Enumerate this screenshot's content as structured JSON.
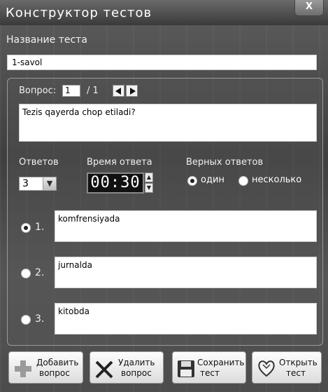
{
  "window": {
    "title": "Конструктор тестов",
    "close_label": "X"
  },
  "test_name": {
    "label": "Название теста",
    "value": "1-savol"
  },
  "question_nav": {
    "label": "Вопрос:",
    "current": "1",
    "total": "/ 1"
  },
  "question_text": "Tezis qayerda chop etiladi?",
  "answers_count": {
    "label": "Ответов",
    "value": "3"
  },
  "answer_time": {
    "label": "Время ответа",
    "value": "00:30"
  },
  "correct_answers": {
    "label": "Верных ответов",
    "options": [
      "один",
      "несколько"
    ],
    "selected": "один"
  },
  "answers": [
    {
      "number": "1.",
      "text": "komfrensiyada",
      "selected": true
    },
    {
      "number": "2.",
      "text": "jurnalda",
      "selected": false
    },
    {
      "number": "3.",
      "text": "kitobda",
      "selected": false
    }
  ],
  "toolbar": {
    "add_line1": "Добавить",
    "add_line2": "вопрос",
    "delete_line1": "Удалить",
    "delete_line2": "вопрос",
    "save_line1": "Сохранить",
    "save_line2": "тест",
    "open_line1": "Открыть",
    "open_line2": "тест"
  },
  "icons": {
    "add": "plus-icon",
    "delete": "cross-icon",
    "save": "floppy-disk-icon",
    "open": "heart-open-icon",
    "prev": "arrow-left-icon",
    "next": "arrow-right-icon"
  }
}
